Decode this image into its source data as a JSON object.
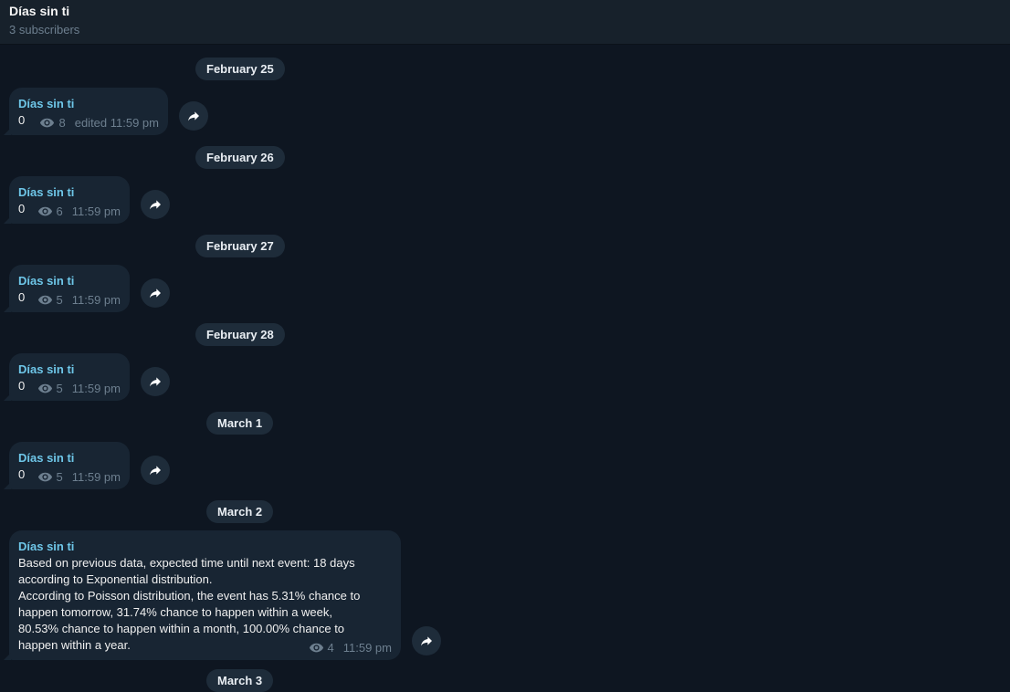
{
  "header": {
    "title": "Días sin ti",
    "subtitle": "3 subscribers"
  },
  "days": [
    {
      "date": "February 25",
      "message": {
        "sender": "Días sin ti",
        "text": "0",
        "views": "8",
        "time": "edited 11:59 pm"
      }
    },
    {
      "date": "February 26",
      "message": {
        "sender": "Días sin ti",
        "text": "0",
        "views": "6",
        "time": "11:59 pm"
      }
    },
    {
      "date": "February 27",
      "message": {
        "sender": "Días sin ti",
        "text": "0",
        "views": "5",
        "time": "11:59 pm"
      }
    },
    {
      "date": "February 28",
      "message": {
        "sender": "Días sin ti",
        "text": "0",
        "views": "5",
        "time": "11:59 pm"
      }
    },
    {
      "date": "March 1",
      "message": {
        "sender": "Días sin ti",
        "text": "0",
        "views": "5",
        "time": "11:59 pm"
      }
    },
    {
      "date": "March 2",
      "message": {
        "sender": "Días sin ti",
        "text": "Based on previous data, expected time until next event: 18 days\naccording to Exponential distribution.\nAccording to Poisson distribution, the event has 5.31% chance to\nhappen tomorrow, 31.74% chance to happen within a week,\n80.53% chance to happen within a month, 100.00% chance to\nhappen within a year.",
        "views": "4",
        "time": "11:59 pm"
      }
    },
    {
      "date": "March 3"
    }
  ],
  "icons": {
    "views": "eye-icon",
    "forward": "forward-arrow-icon"
  },
  "colors": {
    "background": "#0e1621",
    "bubble": "#182533",
    "accent": "#6ec6e8",
    "meta": "#6d7f8f"
  }
}
